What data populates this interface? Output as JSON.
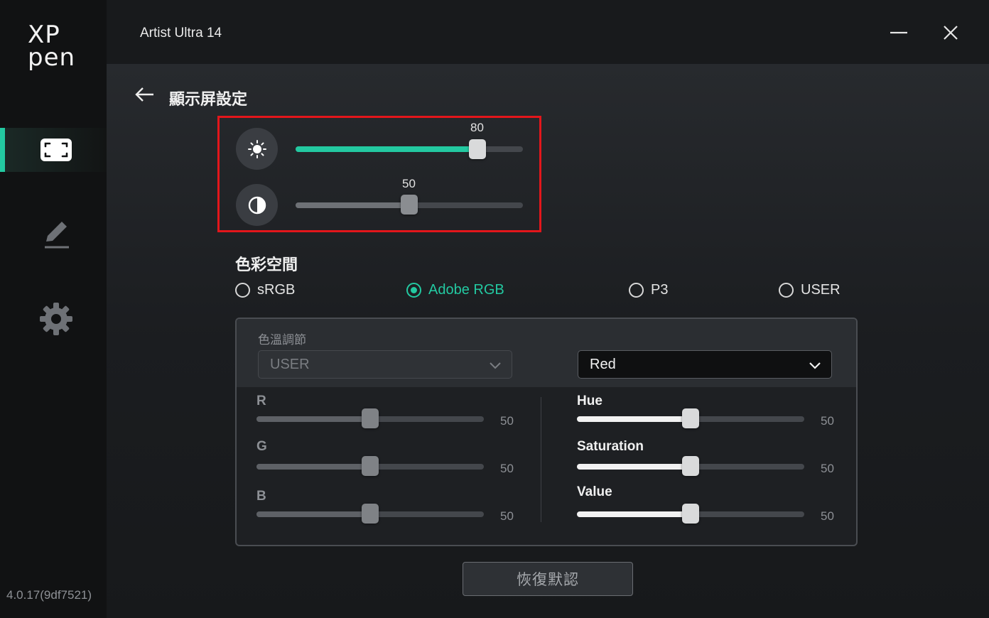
{
  "brand": {
    "line1": "XP",
    "line2": "pen"
  },
  "app": {
    "title": "Artist Ultra 14",
    "version": "4.0.17(9df7521)"
  },
  "sidebar": {
    "items": [
      {
        "name": "display",
        "icon": "display-frame-icon",
        "active": true
      },
      {
        "name": "pen",
        "icon": "pen-icon",
        "active": false
      },
      {
        "name": "settings",
        "icon": "gear-icon",
        "active": false
      }
    ]
  },
  "page": {
    "title": "顯示屏設定"
  },
  "brightness": {
    "icon": "brightness-icon",
    "value": 80,
    "value_label": "80",
    "max": 100
  },
  "contrast": {
    "icon": "contrast-icon",
    "value": 50,
    "value_label": "50",
    "max": 100
  },
  "color_space": {
    "title": "色彩空間",
    "options": [
      {
        "label": "sRGB",
        "checked": false
      },
      {
        "label": "Adobe RGB",
        "checked": true
      },
      {
        "label": "P3",
        "checked": false
      },
      {
        "label": "USER",
        "checked": false
      }
    ]
  },
  "color_temp": {
    "label": "色溫調節",
    "preset": "USER",
    "channel_select": "Red",
    "rgb": [
      {
        "label": "R",
        "value": 50,
        "value_label": "50"
      },
      {
        "label": "G",
        "value": 50,
        "value_label": "50"
      },
      {
        "label": "B",
        "value": 50,
        "value_label": "50"
      }
    ],
    "hsv": [
      {
        "label": "Hue",
        "value": 50,
        "value_label": "50"
      },
      {
        "label": "Saturation",
        "value": 50,
        "value_label": "50"
      },
      {
        "label": "Value",
        "value": 50,
        "value_label": "50"
      }
    ]
  },
  "reset": {
    "label": "恢復默認"
  },
  "colors": {
    "accent": "#23c9a1",
    "highlight_border": "#e3161b"
  }
}
